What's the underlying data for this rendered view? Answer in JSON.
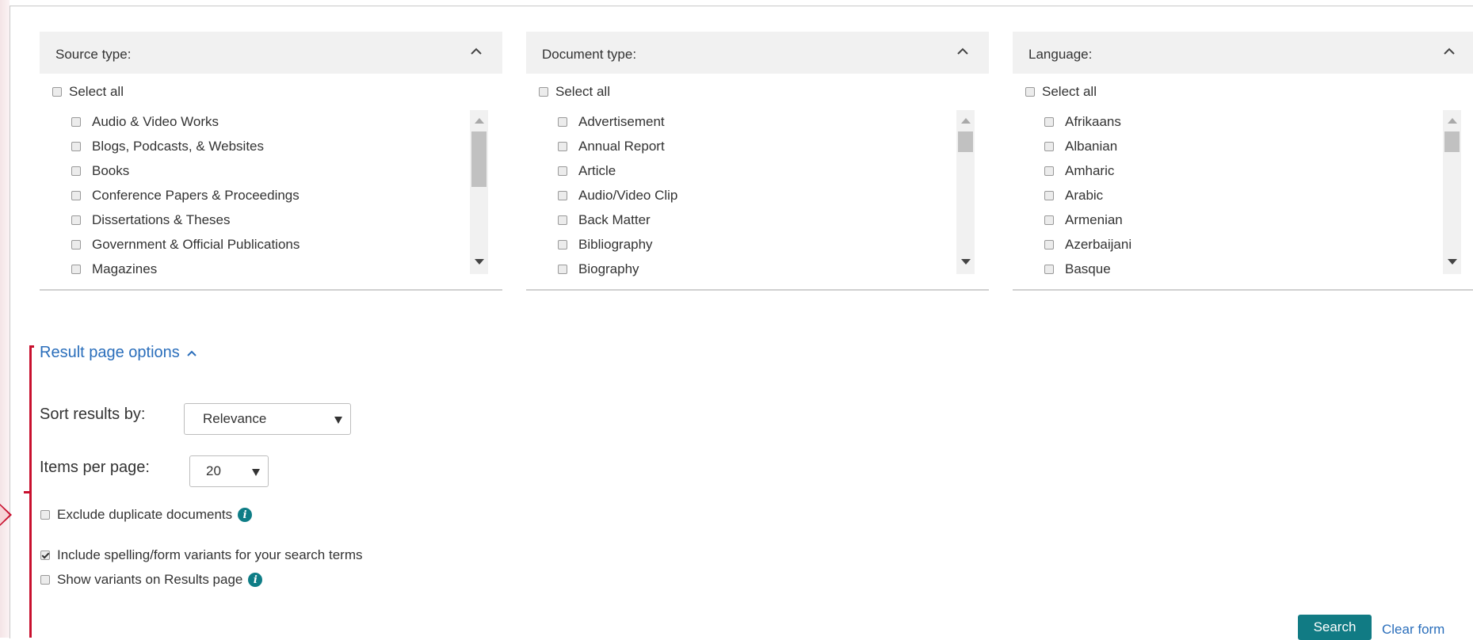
{
  "panels": [
    {
      "title": "Source type:",
      "select_all": "Select all",
      "items": [
        "Audio & Video Works",
        "Blogs, Podcasts, & Websites",
        "Books",
        "Conference Papers & Proceedings",
        "Dissertations & Theses",
        "Government & Official Publications",
        "Magazines"
      ]
    },
    {
      "title": "Document type:",
      "select_all": "Select all",
      "items": [
        "Advertisement",
        "Annual Report",
        "Article",
        "Audio/Video Clip",
        "Back Matter",
        "Bibliography",
        "Biography"
      ]
    },
    {
      "title": "Language:",
      "select_all": "Select all",
      "items": [
        "Afrikaans",
        "Albanian",
        "Amharic",
        "Arabic",
        "Armenian",
        "Azerbaijani",
        "Basque"
      ]
    }
  ],
  "result_options": {
    "toggle_label": "Result page options",
    "sort_label": "Sort results by:",
    "sort_value": "Relevance",
    "items_label": "Items per page:",
    "items_value": "20",
    "exclude_duplicates": "Exclude duplicate documents",
    "include_variants": "Include spelling/form variants for your search terms",
    "include_variants_checked": true,
    "show_variants": "Show variants on Results page"
  },
  "actions": {
    "search": "Search",
    "clear": "Clear form"
  },
  "icons": {
    "collapse": "chevron-up-icon",
    "info": "info-icon",
    "dropdown": "caret-down-icon"
  },
  "colors": {
    "link": "#2a6ebb",
    "primary_button": "#117b84",
    "highlight": "#c8102e"
  }
}
